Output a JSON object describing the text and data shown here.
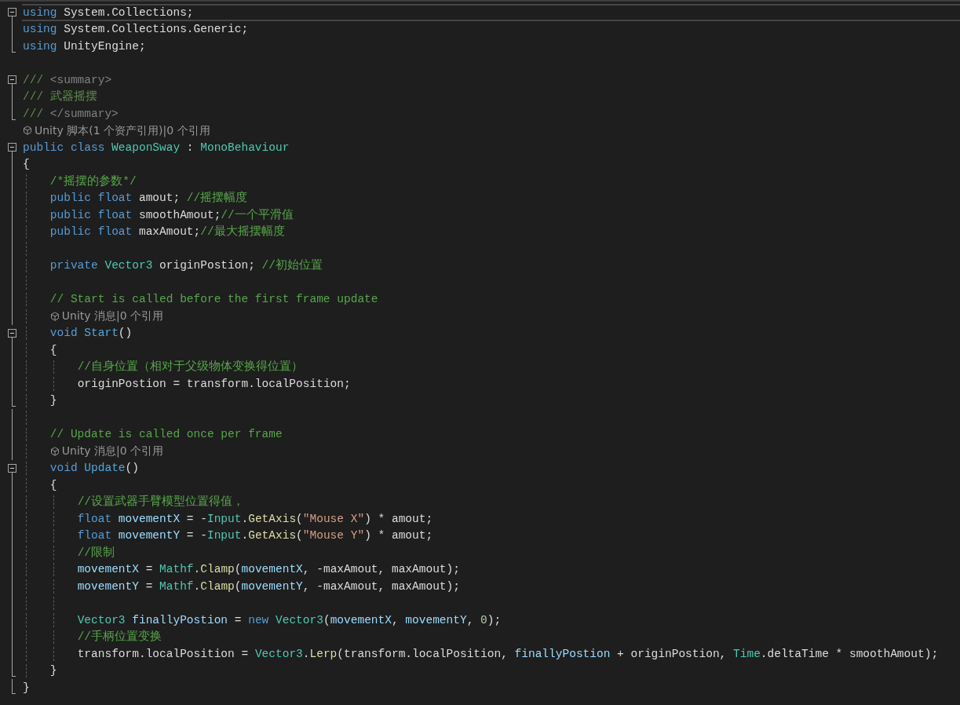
{
  "editor": {
    "lines": [
      {
        "kind": "fold-start",
        "current": true,
        "tokens": [
          {
            "kind": "keyword",
            "text": "using"
          },
          {
            "kind": "plain",
            "text": " System.Collections;"
          }
        ]
      },
      {
        "kind": "fold-inside",
        "current": false,
        "tokens": [
          {
            "kind": "keyword",
            "text": "using"
          },
          {
            "kind": "plain",
            "text": " System.Collections.Generic;"
          }
        ]
      },
      {
        "kind": "fold-end",
        "current": false,
        "tokens": [
          {
            "kind": "keyword",
            "text": "using"
          },
          {
            "kind": "plain",
            "text": " UnityEngine;"
          }
        ]
      },
      {
        "kind": "plain",
        "current": false
      },
      {
        "kind": "fold-start",
        "current": false,
        "tokens": [
          {
            "kind": "doc",
            "text": "///"
          },
          {
            "kind": "doctag",
            "text": " <summary>"
          }
        ]
      },
      {
        "kind": "fold-inside",
        "current": false,
        "tokens": [
          {
            "kind": "doc",
            "text": "/// 武器摇摆"
          }
        ]
      },
      {
        "kind": "fold-end",
        "current": false,
        "tokens": [
          {
            "kind": "doc",
            "text": "///"
          },
          {
            "kind": "doctag",
            "text": " </summary>"
          }
        ]
      },
      {
        "kind": "plain",
        "current": false,
        "tokens": [
          {
            "kind": "lens",
            "text": "Unity 脚本(1 个资产引用)|0 个引用"
          }
        ]
      },
      {
        "kind": "fold-start",
        "current": false,
        "tokens": [
          {
            "kind": "keyword",
            "text": "public class"
          },
          {
            "kind": "type",
            "text": " WeaponSway"
          },
          {
            "kind": "plain",
            "text": " : "
          },
          {
            "kind": "type",
            "text": "MonoBehaviour"
          }
        ]
      },
      {
        "kind": "fold-inside",
        "current": false,
        "tokens": [
          {
            "kind": "plain",
            "text": "{"
          }
        ]
      },
      {
        "kind": "fold-inside",
        "current": false,
        "tokens": [
          {
            "kind": "comment",
            "text": "    /*摇摆的参数*/"
          }
        ]
      },
      {
        "kind": "fold-inside",
        "current": false,
        "tokens": [
          {
            "kind": "keyword",
            "text": "    public float"
          },
          {
            "kind": "plain",
            "text": " amout; "
          },
          {
            "kind": "comment",
            "text": "//摇摆幅度"
          }
        ]
      },
      {
        "kind": "fold-inside",
        "current": false,
        "tokens": [
          {
            "kind": "keyword",
            "text": "    public float"
          },
          {
            "kind": "plain",
            "text": " smoothAmout;"
          },
          {
            "kind": "comment",
            "text": "//一个平滑值"
          }
        ]
      },
      {
        "kind": "fold-inside",
        "current": false,
        "tokens": [
          {
            "kind": "keyword",
            "text": "    public float"
          },
          {
            "kind": "plain",
            "text": " maxAmout;"
          },
          {
            "kind": "comment",
            "text": "//最大摇摆幅度"
          }
        ]
      },
      {
        "kind": "fold-inside",
        "current": false
      },
      {
        "kind": "fold-inside",
        "current": false,
        "tokens": [
          {
            "kind": "keyword",
            "text": "    private"
          },
          {
            "kind": "type",
            "text": " Vector3"
          },
          {
            "kind": "plain",
            "text": " originPostion; "
          },
          {
            "kind": "comment",
            "text": "//初始位置"
          }
        ]
      },
      {
        "kind": "fold-inside",
        "current": false
      },
      {
        "kind": "fold-inside",
        "current": false,
        "tokens": [
          {
            "kind": "comment",
            "text": "    // Start is called before the first frame update"
          }
        ]
      },
      {
        "kind": "fold-inside",
        "current": false,
        "tokens": [
          {
            "kind": "lens",
            "text": "    Unity 消息|0 个引用"
          }
        ]
      },
      {
        "kind": "fold-start",
        "current": false,
        "tokens": [
          {
            "kind": "keyword",
            "text": "    void"
          },
          {
            "kind": "name",
            "text": " Start"
          },
          {
            "kind": "plain",
            "text": "()"
          }
        ]
      },
      {
        "kind": "fold-inside",
        "current": false,
        "tokens": [
          {
            "kind": "plain",
            "text": "    {"
          }
        ]
      },
      {
        "kind": "fold-inside",
        "current": false,
        "tokens": [
          {
            "kind": "comment",
            "text": "        //自身位置（相对于父级物体变换得位置）"
          }
        ]
      },
      {
        "kind": "fold-inside",
        "current": false,
        "tokens": [
          {
            "kind": "plain",
            "text": "        originPostion = transform.localPosition;"
          }
        ]
      },
      {
        "kind": "fold-end",
        "current": false,
        "tokens": [
          {
            "kind": "plain",
            "text": "    }"
          }
        ]
      },
      {
        "kind": "fold-inside",
        "current": false
      },
      {
        "kind": "fold-inside",
        "current": false,
        "tokens": [
          {
            "kind": "comment",
            "text": "    // Update is called once per frame"
          }
        ]
      },
      {
        "kind": "fold-inside",
        "current": false,
        "tokens": [
          {
            "kind": "lens",
            "text": "    Unity 消息|0 个引用"
          }
        ]
      },
      {
        "kind": "fold-start",
        "current": false,
        "tokens": [
          {
            "kind": "keyword",
            "text": "    void"
          },
          {
            "kind": "name",
            "text": " Update"
          },
          {
            "kind": "plain",
            "text": "()"
          }
        ]
      },
      {
        "kind": "fold-inside",
        "current": false,
        "tokens": [
          {
            "kind": "plain",
            "text": "    {"
          }
        ]
      },
      {
        "kind": "fold-inside",
        "current": false,
        "tokens": [
          {
            "kind": "comment",
            "text": "        //设置武器手臂模型位置得值，"
          }
        ]
      },
      {
        "kind": "fold-inside",
        "current": false,
        "tokens": [
          {
            "kind": "keyword",
            "text": "        float"
          },
          {
            "kind": "local",
            "text": " movementX"
          },
          {
            "kind": "plain",
            "text": " = -"
          },
          {
            "kind": "type",
            "text": "Input"
          },
          {
            "kind": "plain",
            "text": "."
          },
          {
            "kind": "method",
            "text": "GetAxis"
          },
          {
            "kind": "plain",
            "text": "("
          },
          {
            "kind": "string",
            "text": "\"Mouse X\""
          },
          {
            "kind": "plain",
            "text": ") * amout;"
          }
        ]
      },
      {
        "kind": "fold-inside",
        "current": false,
        "tokens": [
          {
            "kind": "keyword",
            "text": "        float"
          },
          {
            "kind": "local",
            "text": " movementY"
          },
          {
            "kind": "plain",
            "text": " = -"
          },
          {
            "kind": "type",
            "text": "Input"
          },
          {
            "kind": "plain",
            "text": "."
          },
          {
            "kind": "method",
            "text": "GetAxis"
          },
          {
            "kind": "plain",
            "text": "("
          },
          {
            "kind": "string",
            "text": "\"Mouse Y\""
          },
          {
            "kind": "plain",
            "text": ") * amout;"
          }
        ]
      },
      {
        "kind": "fold-inside",
        "current": false,
        "tokens": [
          {
            "kind": "comment",
            "text": "        //限制"
          }
        ]
      },
      {
        "kind": "fold-inside",
        "current": false,
        "tokens": [
          {
            "kind": "local",
            "text": "        movementX"
          },
          {
            "kind": "plain",
            "text": " = "
          },
          {
            "kind": "type",
            "text": "Mathf"
          },
          {
            "kind": "plain",
            "text": "."
          },
          {
            "kind": "method",
            "text": "Clamp"
          },
          {
            "kind": "plain",
            "text": "("
          },
          {
            "kind": "local",
            "text": "movementX"
          },
          {
            "kind": "plain",
            "text": ", -maxAmout, maxAmout);"
          }
        ]
      },
      {
        "kind": "fold-inside",
        "current": false,
        "tokens": [
          {
            "kind": "local",
            "text": "        movementY"
          },
          {
            "kind": "plain",
            "text": " = "
          },
          {
            "kind": "type",
            "text": "Mathf"
          },
          {
            "kind": "plain",
            "text": "."
          },
          {
            "kind": "method",
            "text": "Clamp"
          },
          {
            "kind": "plain",
            "text": "("
          },
          {
            "kind": "local",
            "text": "movementY"
          },
          {
            "kind": "plain",
            "text": ", -maxAmout, maxAmout);"
          }
        ]
      },
      {
        "kind": "fold-inside",
        "current": false
      },
      {
        "kind": "fold-inside",
        "current": false,
        "tokens": [
          {
            "kind": "type",
            "text": "        Vector3"
          },
          {
            "kind": "local",
            "text": " finallyPostion"
          },
          {
            "kind": "plain",
            "text": " = "
          },
          {
            "kind": "keyword",
            "text": "new"
          },
          {
            "kind": "type",
            "text": " Vector3"
          },
          {
            "kind": "plain",
            "text": "("
          },
          {
            "kind": "local",
            "text": "movementX"
          },
          {
            "kind": "plain",
            "text": ", "
          },
          {
            "kind": "local",
            "text": "movementY"
          },
          {
            "kind": "plain",
            "text": ", "
          },
          {
            "kind": "number",
            "text": "0"
          },
          {
            "kind": "plain",
            "text": ");"
          }
        ]
      },
      {
        "kind": "fold-inside",
        "current": false,
        "tokens": [
          {
            "kind": "comment",
            "text": "        //手柄位置变换"
          }
        ]
      },
      {
        "kind": "fold-inside",
        "current": false,
        "tokens": [
          {
            "kind": "plain",
            "text": "        transform.localPosition = "
          },
          {
            "kind": "type",
            "text": "Vector3"
          },
          {
            "kind": "plain",
            "text": "."
          },
          {
            "kind": "method",
            "text": "Lerp"
          },
          {
            "kind": "plain",
            "text": "(transform.localPosition, "
          },
          {
            "kind": "local",
            "text": "finallyPostion"
          },
          {
            "kind": "plain",
            "text": " + originPostion, "
          },
          {
            "kind": "type",
            "text": "Time"
          },
          {
            "kind": "plain",
            "text": ".deltaTime * smoothAmout);"
          }
        ]
      },
      {
        "kind": "fold-end",
        "current": false,
        "tokens": [
          {
            "kind": "plain",
            "text": "    }"
          }
        ]
      },
      {
        "kind": "fold-end",
        "current": false,
        "tokens": [
          {
            "kind": "plain",
            "text": "}"
          }
        ]
      }
    ]
  }
}
